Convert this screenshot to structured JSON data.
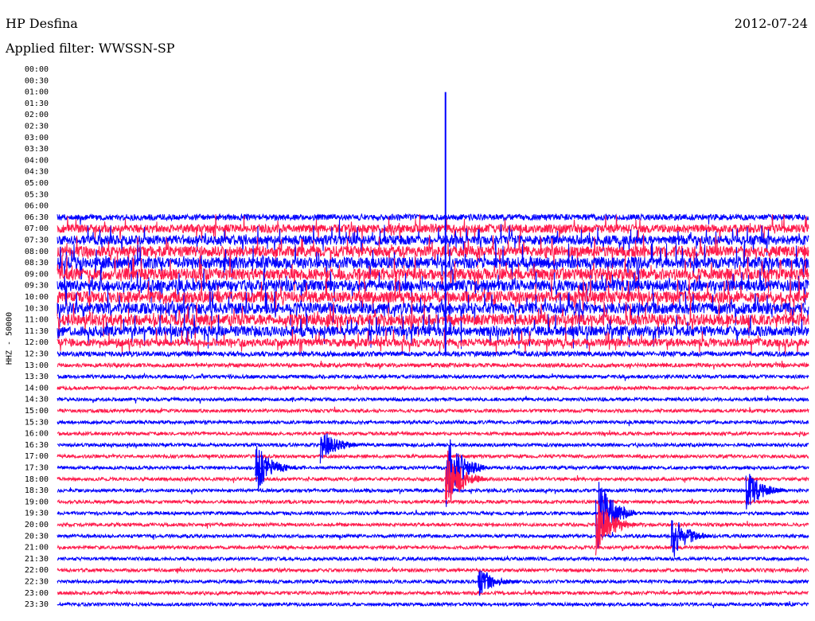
{
  "header": {
    "station": "HP Desfina",
    "date": "2012-07-24",
    "filter": "Applied filter: WWSSN-SP"
  },
  "chart_data": {
    "type": "line",
    "title": "HP Desfina",
    "subtitle": "Applied filter: WWSSN-SP",
    "date": "2012-07-24",
    "ylabel": "HHZ - 50000",
    "xlabel": "",
    "x_range_minutes": [
      0,
      30
    ],
    "tick_labels": [
      "00:00",
      "00:30",
      "01:00",
      "01:30",
      "02:00",
      "02:30",
      "03:00",
      "03:30",
      "04:00",
      "04:30",
      "05:00",
      "05:30",
      "06:00",
      "06:30",
      "07:00",
      "07:30",
      "08:00",
      "08:30",
      "09:00",
      "09:30",
      "10:00",
      "10:30",
      "11:00",
      "11:30",
      "12:00",
      "12:30",
      "13:00",
      "13:30",
      "14:00",
      "14:30",
      "15:00",
      "15:30",
      "16:00",
      "16:30",
      "17:00",
      "17:30",
      "18:00",
      "18:30",
      "19:00",
      "19:30",
      "20:00",
      "20:30",
      "21:00",
      "21:30",
      "22:00",
      "22:30",
      "23:00",
      "23:30"
    ],
    "colors": {
      "even_rows": "#ff1a4b",
      "odd_rows": "#0000ff"
    },
    "grid": false,
    "data_start_row": "06:30",
    "amplitude_profile": [
      {
        "row": "06:30",
        "level": 0.55
      },
      {
        "row": "07:00",
        "level": 0.75
      },
      {
        "row": "07:30",
        "level": 0.85
      },
      {
        "row": "08:00",
        "level": 0.95
      },
      {
        "row": "08:30",
        "level": 1.0
      },
      {
        "row": "09:00",
        "level": 1.0
      },
      {
        "row": "09:30",
        "level": 1.0
      },
      {
        "row": "10:00",
        "level": 1.0
      },
      {
        "row": "10:30",
        "level": 1.0
      },
      {
        "row": "11:00",
        "level": 1.0
      },
      {
        "row": "11:30",
        "level": 0.9
      },
      {
        "row": "12:00",
        "level": 0.7
      },
      {
        "row": "12:30",
        "level": 0.45
      },
      {
        "row": "13:00",
        "level": 0.35
      },
      {
        "row": "13:30",
        "level": 0.32
      },
      {
        "row": "14:00",
        "level": 0.3
      },
      {
        "row": "14:30",
        "level": 0.3
      },
      {
        "row": "15:00",
        "level": 0.3
      },
      {
        "row": "15:30",
        "level": 0.3
      },
      {
        "row": "16:00",
        "level": 0.3
      },
      {
        "row": "16:30",
        "level": 0.3
      },
      {
        "row": "17:00",
        "level": 0.3
      },
      {
        "row": "17:30",
        "level": 0.3
      },
      {
        "row": "18:00",
        "level": 0.3
      },
      {
        "row": "18:30",
        "level": 0.3
      },
      {
        "row": "19:00",
        "level": 0.3
      },
      {
        "row": "19:30",
        "level": 0.3
      },
      {
        "row": "20:00",
        "level": 0.3
      },
      {
        "row": "20:30",
        "level": 0.3
      },
      {
        "row": "21:00",
        "level": 0.3
      },
      {
        "row": "21:30",
        "level": 0.3
      },
      {
        "row": "22:00",
        "level": 0.3
      },
      {
        "row": "22:30",
        "level": 0.3
      },
      {
        "row": "23:00",
        "level": 0.3
      },
      {
        "row": "23:30",
        "level": 0.3
      }
    ],
    "events": [
      {
        "row": "01:30",
        "minute": 15.5,
        "spike_rows_up": 2.0,
        "spike_rows_down": 22,
        "note": "large spike across rows"
      },
      {
        "row": "17:30",
        "minute": 15.5,
        "amplitude": 3.0
      },
      {
        "row": "18:00",
        "minute": 15.5,
        "amplitude": 2.5
      },
      {
        "row": "17:30",
        "minute": 7.9,
        "amplitude": 2.0
      },
      {
        "row": "19:30",
        "minute": 21.5,
        "amplitude": 3.2
      },
      {
        "row": "20:00",
        "minute": 21.5,
        "amplitude": 2.5
      },
      {
        "row": "20:30",
        "minute": 24.5,
        "amplitude": 2.0
      },
      {
        "row": "18:30",
        "minute": 27.5,
        "amplitude": 1.6
      },
      {
        "row": "16:30",
        "minute": 10.5,
        "amplitude": 1.4
      },
      {
        "row": "22:30",
        "minute": 16.8,
        "amplitude": 1.2
      }
    ]
  }
}
